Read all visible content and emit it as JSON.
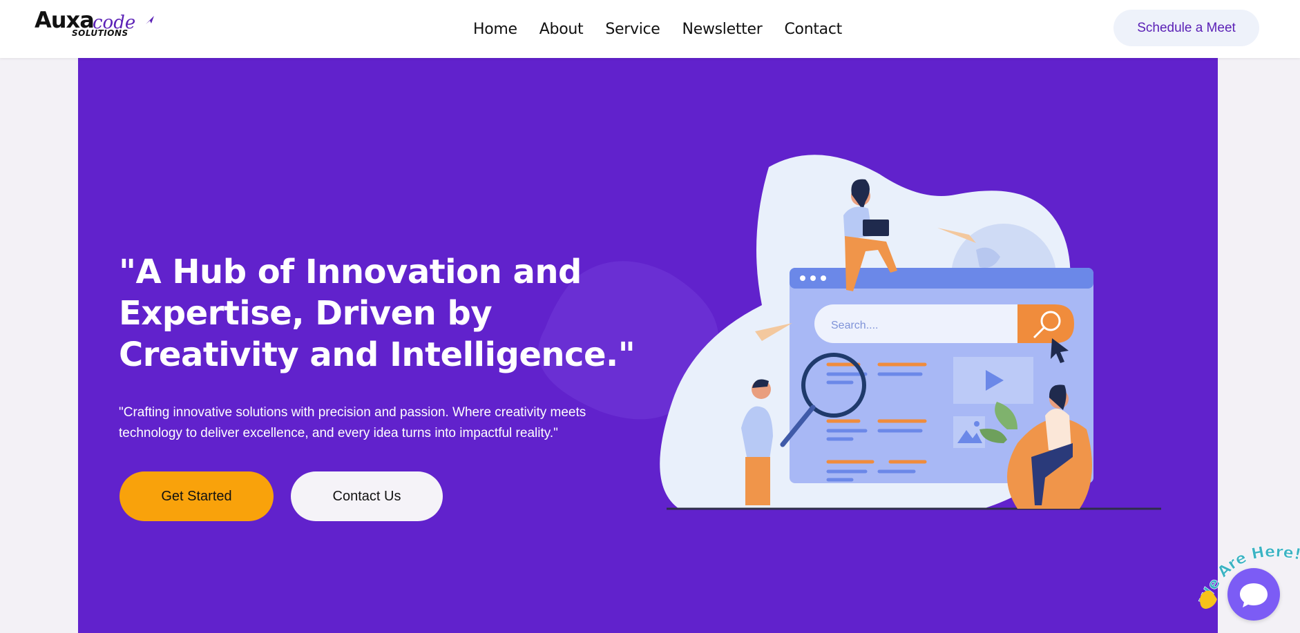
{
  "header": {
    "logo": {
      "main": "Auxa",
      "accent": "code",
      "sub": "SOLUTIONS"
    },
    "nav": [
      "Home",
      "About",
      "Service",
      "Newsletter",
      "Contact"
    ],
    "cta_label": "Schedule a Meet"
  },
  "hero": {
    "headline": "\"A Hub of Innovation and Expertise, Driven by Creativity and Intelligence.\"",
    "subtext": "\"Crafting innovative solutions with precision and passion. Where creativity meets technology to deliver excellence, and every idea turns into impactful reality.\"",
    "primary_button": "Get Started",
    "secondary_button": "Contact Us",
    "illustration": {
      "search_placeholder": "Search...."
    }
  },
  "chat_widget": {
    "label": "We Are Here!",
    "icon": "chat-bubble-icon"
  },
  "colors": {
    "hero_bg": "#6122cc",
    "accent": "#f9a20b",
    "brand": "#5b21b6",
    "page_bg": "#f3f1f6"
  }
}
